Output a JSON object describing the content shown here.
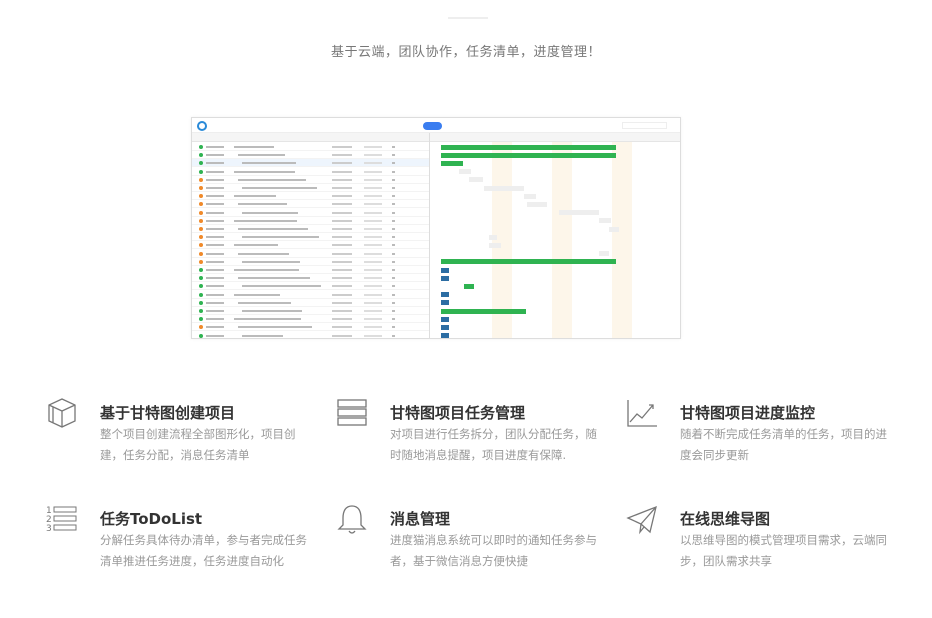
{
  "header": {
    "subtitle": "基于云端，团队协作，任务清单，进度管理！"
  },
  "features": [
    {
      "title": "基于甘特图创建项目",
      "desc": "整个项目创建流程全部图形化，项目创建，任务分配，消息任务清单",
      "icon": "cube-icon"
    },
    {
      "title": "甘特图项目任务管理",
      "desc": "对项目进行任务拆分，团队分配任务，随时随地消息提醒，项目进度有保障.",
      "icon": "server-icon"
    },
    {
      "title": "甘特图项目进度监控",
      "desc": "随着不断完成任务清单的任务，项目的进度会同步更新",
      "icon": "line-chart-icon"
    },
    {
      "title": "任务ToDoList",
      "desc": "分解任务具体待办清单，参与者完成任务清单推进任务进度，任务进度自动化",
      "icon": "numbered-list-icon"
    },
    {
      "title": "消息管理",
      "desc": "进度猫消息系统可以即时的通知任务参与者，基于微信消息方便快捷",
      "icon": "bell-icon"
    },
    {
      "title": "在线思维导图",
      "desc": "以思维导图的模式管理项目需求，云端同步，团队需求共享",
      "icon": "paper-plane-icon"
    }
  ],
  "colors": {
    "accent": "#3a7df0",
    "bar": "#2fb351",
    "dark": "#2c6da3"
  }
}
